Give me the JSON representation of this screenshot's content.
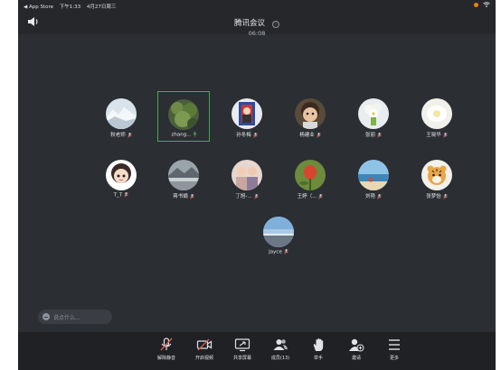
{
  "status_bar": {
    "back_app": "◀ App Store",
    "time": "下午1:33",
    "date": "4月27日周三"
  },
  "header": {
    "title": "腾讯会议",
    "info_icon": "ⓘ",
    "timer": "06:08"
  },
  "participants": [
    {
      "name": "秋老师",
      "avatar": "snow-landscape",
      "mic": "muted"
    },
    {
      "name": "zhang...",
      "avatar": "green-plant",
      "mic": "active",
      "active": true
    },
    {
      "name": "孙冬梅",
      "avatar": "portrait-photo",
      "mic": "muted"
    },
    {
      "name": "杨建业",
      "avatar": "cartoon-character",
      "mic": "muted"
    },
    {
      "name": "张丽",
      "avatar": "flowers",
      "mic": "muted"
    },
    {
      "name": "王晓华",
      "avatar": "white-flower",
      "mic": "muted"
    },
    {
      "name": "T_T",
      "avatar": "cartoon-girl",
      "mic": "muted"
    },
    {
      "name": "蒋书娟",
      "avatar": "mountain-lake",
      "mic": "muted"
    },
    {
      "name": "丁旭-...",
      "avatar": "group-photo",
      "mic": "muted"
    },
    {
      "name": "王婷（...",
      "avatar": "red-tulip",
      "mic": "muted"
    },
    {
      "name": "刘艳",
      "avatar": "beach",
      "mic": "muted"
    },
    {
      "name": "张梦怡",
      "avatar": "tiger",
      "mic": "muted"
    },
    {
      "name": "Jayce",
      "avatar": "sky-horizon",
      "mic": "muted"
    }
  ],
  "chat": {
    "placeholder": "说点什么..."
  },
  "toolbar": {
    "unmute": "解除静音",
    "start_video": "开启视频",
    "share_screen": "共享屏幕",
    "members": "成员(13)",
    "raise_hand": "举手",
    "invite": "邀请",
    "more": "更多"
  },
  "colors": {
    "background": "#2b2e33",
    "toolbar": "#1f2125",
    "active_speaker_border": "#3fae4c",
    "muted_mic": "#e05a4f",
    "battery": "#e8801a"
  }
}
